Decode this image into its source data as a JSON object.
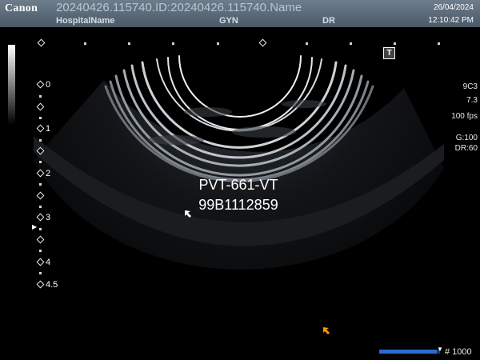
{
  "header": {
    "brand": "Canon",
    "patient_line": "20240426.115740.ID:20240426.115740.Name",
    "hospital": "HospitalName",
    "exam": "GYN",
    "operator": "DR",
    "date": "26/04/2024",
    "time": "12:10:42 PM"
  },
  "depth_scale": {
    "labels": [
      "0",
      "1",
      "2",
      "3",
      "4",
      "4.5"
    ]
  },
  "params": {
    "probe": "9C3",
    "frequency": "7.3",
    "frame_rate": "100 fps",
    "gain": "G:100",
    "dynamic_range": "DR:60"
  },
  "annotation": {
    "line1": "PVT-661-VT",
    "line2": "99B1112859"
  },
  "cine": {
    "frame_count": "# 1000",
    "position": 0.95
  },
  "colors": {
    "header_bg": "#5b6b7a",
    "cine_bar": "#2b6ad4",
    "pointer": "#ff9900"
  }
}
